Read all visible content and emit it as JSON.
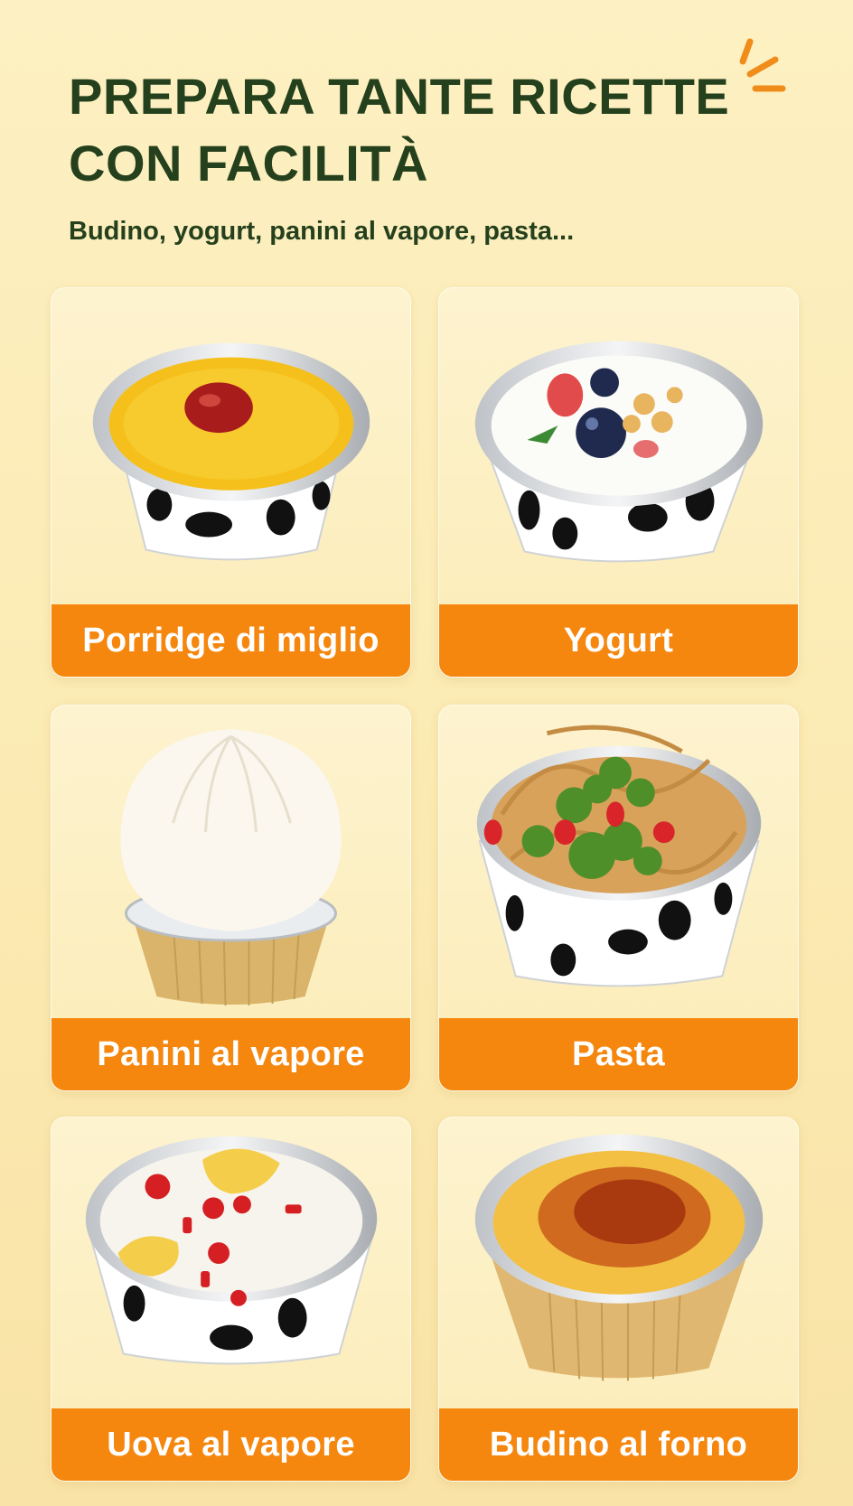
{
  "header": {
    "title_line1": "PREPARA TANTE RICETTE",
    "title_line2": "CON FACILITÀ",
    "subtitle": "Budino, yogurt, panini al vapore, pasta..."
  },
  "colors": {
    "title": "#24401c",
    "label_background": "#f5870f",
    "label_text": "#ffffff",
    "accent_sparks": "#f08c1a"
  },
  "cards": [
    {
      "label": "Porridge di miglio",
      "image": "millet-porridge-cup"
    },
    {
      "label": "Yogurt",
      "image": "yogurt-cup"
    },
    {
      "label": "Panini al vapore",
      "image": "steamed-bun-cup"
    },
    {
      "label": "Pasta",
      "image": "pasta-cup"
    },
    {
      "label": "Uova al vapore",
      "image": "steamed-egg-cup"
    },
    {
      "label": "Budino al forno",
      "image": "baked-pudding-cup"
    }
  ]
}
